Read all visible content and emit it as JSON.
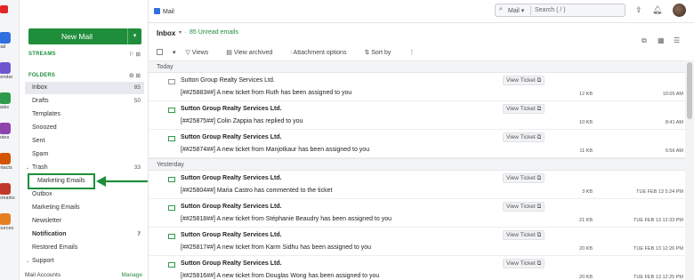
{
  "rail": {
    "items": [
      {
        "label": "Mail",
        "color": "#2f6fdf",
        "icon": "mail-icon"
      },
      {
        "label": "alendar",
        "color": "#6e56cf",
        "icon": "calendar-icon"
      },
      {
        "label": "Tasks",
        "color": "#2f9a4a",
        "icon": "tasks-icon"
      },
      {
        "label": "Notes",
        "color": "#8e44ad",
        "icon": "notes-icon"
      },
      {
        "label": "ontacts",
        "color": "#d35400",
        "icon": "contacts-icon"
      },
      {
        "label": "okmarks",
        "color": "#c0392b",
        "icon": "bookmarks-icon"
      },
      {
        "label": "sources",
        "color": "#e67e22",
        "icon": "resources-icon"
      }
    ]
  },
  "sidebar": {
    "new_mail": "New Mail",
    "streams": "STREAMS",
    "folders": "FOLDERS",
    "items": [
      {
        "label": "Inbox",
        "count": "85",
        "selected": true,
        "bold": false
      },
      {
        "label": "Drafts",
        "count": "50"
      },
      {
        "label": "Templates",
        "count": ""
      },
      {
        "label": "Snoozed",
        "count": ""
      },
      {
        "label": "Sent",
        "count": ""
      },
      {
        "label": "Spam",
        "count": ""
      },
      {
        "label": "Trash",
        "count": "33",
        "twisty": true
      },
      {
        "label": "Marketing Emails",
        "count": "",
        "child": true
      },
      {
        "label": "Outbox",
        "count": ""
      },
      {
        "label": "Marketing Emails",
        "count": ""
      },
      {
        "label": "Newsletter",
        "count": ""
      },
      {
        "label": "Notification",
        "count": "7",
        "bold": true
      },
      {
        "label": "Restored Emails",
        "count": ""
      },
      {
        "label": "Support",
        "count": "",
        "twisty": true
      }
    ],
    "footer_left": "Mail Accounts",
    "footer_right": "Manage"
  },
  "topbar": {
    "tab": "Mail",
    "search_scope": "Mail",
    "search_placeholder": "Search ( / )"
  },
  "list": {
    "title": "Inbox",
    "unread": "85 Unread emails",
    "actions": {
      "views": "Views",
      "archived": "View archived",
      "attachment": "Attachment options",
      "sort": "Sort by"
    },
    "view_ticket": "View Ticket",
    "groups": [
      {
        "label": "Today",
        "rows": [
          {
            "sender": "Sutton Group Realty Services Ltd.",
            "subject": "[##25883##] A new ticket from Ruth has been assigned to you",
            "size": "12 KB",
            "time": "10:05 AM",
            "read": true
          },
          {
            "sender": "Sutton Group Realty Services Ltd.",
            "subject": "[##25875##] Colin Zappia has replied to you",
            "size": "10 KB",
            "time": "8:41 AM",
            "read": false
          },
          {
            "sender": "Sutton Group Realty Services Ltd.",
            "subject": "[##25874##] A new ticket from Manjotkaur has been assigned to you",
            "size": "11 KB",
            "time": "6:56 AM",
            "read": false
          }
        ]
      },
      {
        "label": "Yesterday",
        "rows": [
          {
            "sender": "Sutton Group Realty Services Ltd.",
            "subject": "[##25804##] Maria Castro has commented to the ticket",
            "size": "3 KB",
            "time": "TUE FEB 13 5:24 PM",
            "read": false
          },
          {
            "sender": "Sutton Group Realty Services Ltd.",
            "subject": "[##25818##] A new ticket from Stéphanie Beaudry has been assigned to you",
            "size": "21 KB",
            "time": "TUE FEB 13 12:33 PM",
            "read": false
          },
          {
            "sender": "Sutton Group Realty Services Ltd.",
            "subject": "[##25817##] A new ticket from Karm Sidhu has been assigned to you",
            "size": "20 KB",
            "time": "TUE FEB 13 12:26 PM",
            "read": false
          },
          {
            "sender": "Sutton Group Realty Services Ltd.",
            "subject": "[##25816##] A new ticket from Douglas Wong has been assigned to you",
            "size": "20 KB",
            "time": "TUE FEB 13 12:25 PM",
            "read": false
          }
        ]
      }
    ]
  },
  "colors": {
    "accent": "#1f8e3b",
    "brand": "#e42527"
  }
}
